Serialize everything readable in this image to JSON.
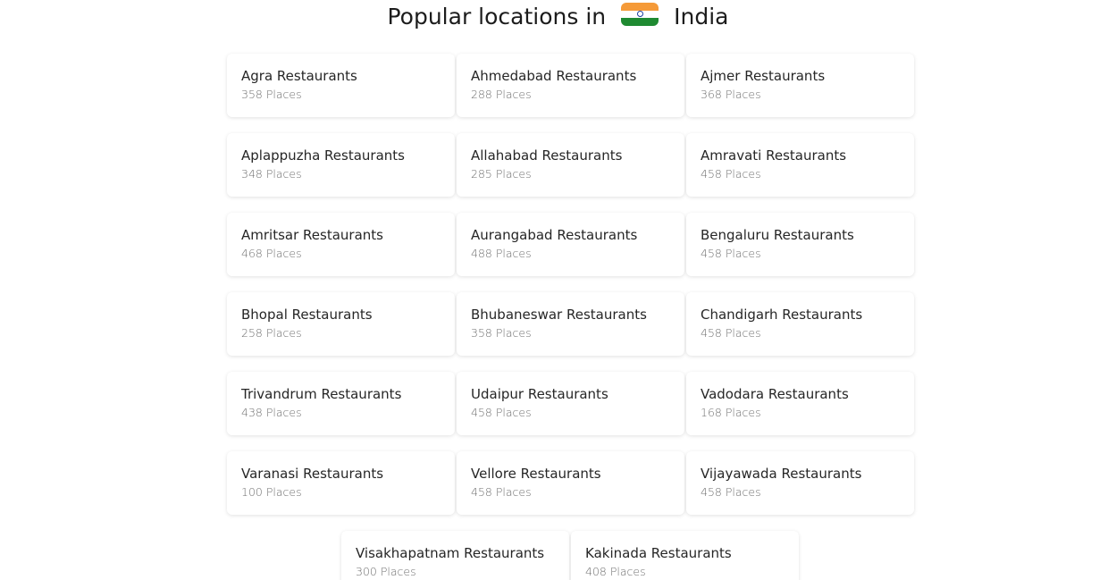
{
  "heading": {
    "prefix": "Popular locations in",
    "country": "India",
    "flag_icon": "india-flag-icon"
  },
  "locations": [
    {
      "name": "Agra Restaurants",
      "places": "358 Places"
    },
    {
      "name": "Ahmedabad Restaurants",
      "places": "288 Places"
    },
    {
      "name": "Ajmer Restaurants",
      "places": "368 Places"
    },
    {
      "name": "Aplappuzha Restaurants",
      "places": "348 Places"
    },
    {
      "name": "Allahabad Restaurants",
      "places": "285 Places"
    },
    {
      "name": "Amravati Restaurants",
      "places": "458 Places"
    },
    {
      "name": "Amritsar Restaurants",
      "places": "468 Places"
    },
    {
      "name": "Aurangabad Restaurants",
      "places": "488 Places"
    },
    {
      "name": "Bengaluru Restaurants",
      "places": "458 Places"
    },
    {
      "name": "Bhopal Restaurants",
      "places": "258 Places"
    },
    {
      "name": "Bhubaneswar Restaurants",
      "places": "358 Places"
    },
    {
      "name": "Chandigarh Restaurants",
      "places": "458 Places"
    },
    {
      "name": "Trivandrum Restaurants",
      "places": "438 Places"
    },
    {
      "name": "Udaipur Restaurants",
      "places": "458 Places"
    },
    {
      "name": "Vadodara Restaurants",
      "places": "168 Places"
    },
    {
      "name": "Varanasi Restaurants",
      "places": "100 Places"
    },
    {
      "name": "Vellore Restaurants",
      "places": "458 Places"
    },
    {
      "name": "Vijayawada Restaurants",
      "places": "458 Places"
    },
    {
      "name": "Visakhapatnam Restaurants",
      "places": "300 Places"
    },
    {
      "name": "Kakinada Restaurants",
      "places": "408 Places"
    }
  ],
  "colors": {
    "flag_saffron": "#f59a38",
    "flag_white": "#ffffff",
    "flag_green": "#1f8a31",
    "flag_chakra": "#1c3f9a"
  }
}
